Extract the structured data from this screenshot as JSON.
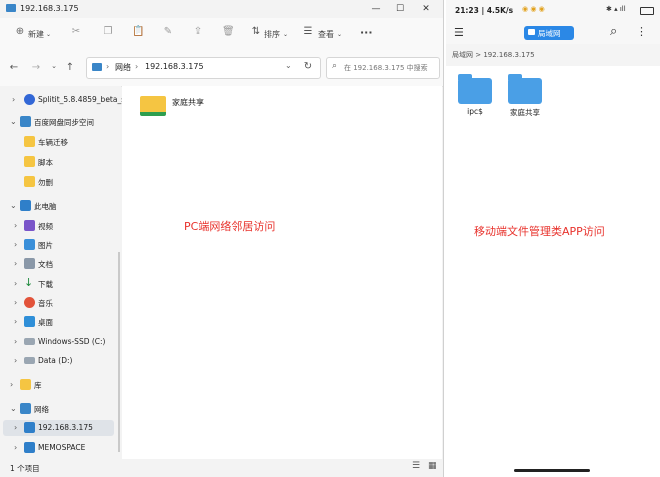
{
  "pc": {
    "window_title": "192.168.3.175",
    "toolbar": {
      "new_label": "新建",
      "sort_label": "排序",
      "view_label": "查看",
      "more_label": "···"
    },
    "address": {
      "root": "网络",
      "host": "192.168.3.175",
      "search_placeholder": "在 192.168.3.175 中搜索"
    },
    "nav": [
      {
        "label": "Splitit_5.8.4859_beta_s",
        "chev": "›"
      },
      {
        "label": "百度网盘同步空间",
        "chev": "⌄"
      },
      {
        "label": "车辆迁移",
        "chev": ""
      },
      {
        "label": "脚本",
        "chev": ""
      },
      {
        "label": "勿删",
        "chev": ""
      },
      {
        "label": "此电脑",
        "chev": "⌄"
      },
      {
        "label": "视频",
        "chev": "›"
      },
      {
        "label": "图片",
        "chev": "›"
      },
      {
        "label": "文档",
        "chev": "›"
      },
      {
        "label": "下载",
        "chev": "›"
      },
      {
        "label": "音乐",
        "chev": "›"
      },
      {
        "label": "桌面",
        "chev": "›"
      },
      {
        "label": "Windows-SSD (C:)",
        "chev": "›"
      },
      {
        "label": "Data (D:)",
        "chev": "›"
      },
      {
        "label": "库",
        "chev": "›"
      },
      {
        "label": "网络",
        "chev": "⌄"
      },
      {
        "label": "192.168.3.175",
        "chev": "›"
      },
      {
        "label": "MEMOSPACE",
        "chev": "›"
      }
    ],
    "content_item": "家庭共享",
    "status_text": "1 个项目",
    "annotation": "PC端网络邻居访问"
  },
  "mobile": {
    "status_time": "21:23 | 4.5K/s",
    "appbar_tab": "局域网",
    "breadcrumb": "局域网 > 192.168.3.175",
    "folders": [
      "ipc$",
      "家庭共享"
    ],
    "annotation": "移动端文件管理类APP访问"
  },
  "colors": {
    "accent": "#0067c0",
    "folder_yellow": "#f5c542",
    "mobile_folder": "#4a9fe6",
    "annotation_red": "#e8322c"
  }
}
